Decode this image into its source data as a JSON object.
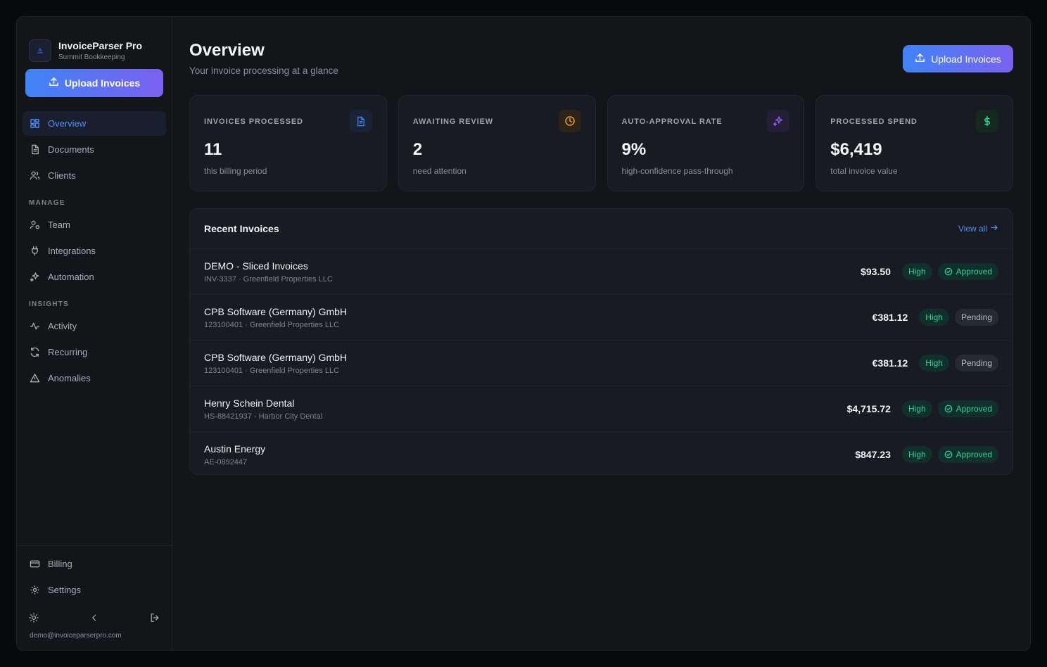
{
  "brand": {
    "name": "InvoiceParser Pro",
    "subtitle": "Summit Bookkeeping"
  },
  "sidebar": {
    "upload_label": "Upload Invoices",
    "primary": [
      {
        "label": "Overview",
        "icon": "grid-icon",
        "active": true
      },
      {
        "label": "Documents",
        "icon": "document-icon"
      },
      {
        "label": "Clients",
        "icon": "users-icon"
      }
    ],
    "manage_heading": "MANAGE",
    "manage": [
      {
        "label": "Team",
        "icon": "team-icon"
      },
      {
        "label": "Integrations",
        "icon": "plug-icon"
      },
      {
        "label": "Automation",
        "icon": "sparkles-icon"
      }
    ],
    "insights_heading": "INSIGHTS",
    "insights": [
      {
        "label": "Activity",
        "icon": "activity-icon"
      },
      {
        "label": "Recurring",
        "icon": "refresh-icon"
      },
      {
        "label": "Anomalies",
        "icon": "warning-icon"
      }
    ],
    "bottom": [
      {
        "label": "Billing",
        "icon": "card-icon"
      },
      {
        "label": "Settings",
        "icon": "gear-icon"
      }
    ],
    "email": "demo@invoiceparserpro.com"
  },
  "header": {
    "title": "Overview",
    "subtitle": "Your invoice processing at a glance",
    "upload_label": "Upload Invoices"
  },
  "stats": [
    {
      "label": "INVOICES PROCESSED",
      "value": "11",
      "hint": "this billing period",
      "icon": "document-icon",
      "color": "#3f84f6"
    },
    {
      "label": "AWAITING REVIEW",
      "value": "2",
      "hint": "need attention",
      "icon": "clock-icon",
      "color": "#f0a020"
    },
    {
      "label": "AUTO-APPROVAL RATE",
      "value": "9%",
      "hint": "high-confidence pass-through",
      "icon": "sparkles-icon",
      "color": "#8b5cf6"
    },
    {
      "label": "PROCESSED SPEND",
      "value": "$6,419",
      "hint": "total invoice value",
      "icon": "dollar-icon",
      "color": "#2fd29a"
    }
  ],
  "recent": {
    "title": "Recent Invoices",
    "view_all": "View all",
    "rows": [
      {
        "name": "DEMO - Sliced Invoices",
        "meta": "INV-3337 · Greenfield Properties LLC",
        "amount": "$93.50",
        "confidence": "High",
        "status": "Approved"
      },
      {
        "name": "CPB Software (Germany) GmbH",
        "meta": "123100401 · Greenfield Properties LLC",
        "amount": "€381.12",
        "confidence": "High",
        "status": "Pending"
      },
      {
        "name": "CPB Software (Germany) GmbH",
        "meta": "123100401 · Greenfield Properties LLC",
        "amount": "€381.12",
        "confidence": "High",
        "status": "Pending"
      },
      {
        "name": "Henry Schein Dental",
        "meta": "HS-88421937 · Harbor City Dental",
        "amount": "$4,715.72",
        "confidence": "High",
        "status": "Approved"
      },
      {
        "name": "Austin Energy",
        "meta": "AE-0892447",
        "amount": "$847.23",
        "confidence": "High",
        "status": "Approved"
      }
    ]
  }
}
